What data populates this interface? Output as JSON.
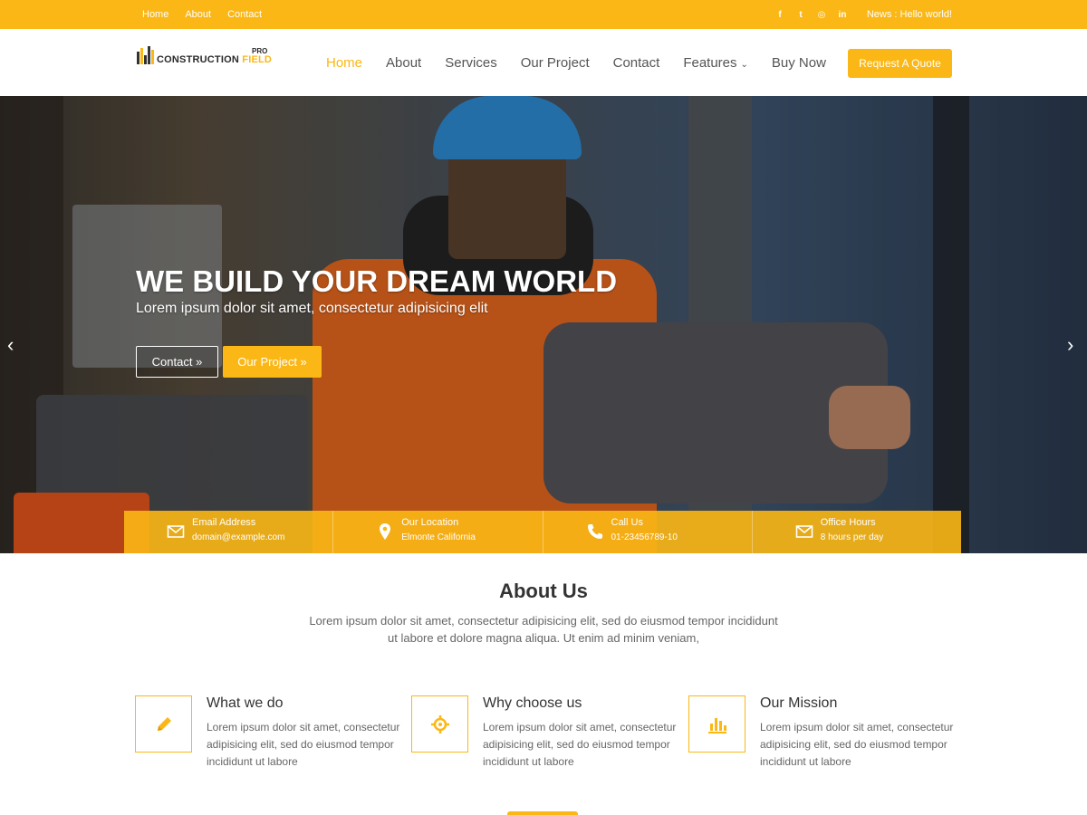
{
  "colors": {
    "accent": "#fbb715",
    "text": "#333333",
    "muted": "#666666"
  },
  "topbar": {
    "links": [
      "Home",
      "About",
      "Contact"
    ],
    "social_icons": [
      "facebook-icon",
      "twitter-icon",
      "instagram-icon",
      "linkedin-icon"
    ],
    "social_glyphs": [
      "f",
      "t",
      "◎",
      "in"
    ],
    "news": "News : Hello world!"
  },
  "logo": {
    "brand_dark": "CONSTRUCTION",
    "brand_accent": "FIELD",
    "badge": "PRO"
  },
  "nav": {
    "items": [
      "Home",
      "About",
      "Services",
      "Our Project",
      "Contact",
      "Features",
      "Buy Now"
    ],
    "active": "Home",
    "cta": "Request A Quote"
  },
  "hero": {
    "headline": "WE BUILD YOUR DREAM WORLD",
    "subheading": "Lorem ipsum dolor sit amet, consectetur adipisicing elit",
    "btn_contact": "Contact »",
    "btn_project": "Our Project »",
    "prev_arrow": "‹",
    "next_arrow": "›"
  },
  "info": [
    {
      "icon": "envelope-icon",
      "title": "Email Address",
      "value": "domain@example.com"
    },
    {
      "icon": "map-marker-icon",
      "title": "Our Location",
      "value": "Elmonte California"
    },
    {
      "icon": "phone-icon",
      "title": "Call Us",
      "value": "01-23456789-10"
    },
    {
      "icon": "envelope-icon",
      "title": "Office Hours",
      "value": "8 hours per day"
    }
  ],
  "about": {
    "title": "About Us",
    "text": "Lorem ipsum dolor sit amet, consectetur adipisicing elit, sed do eiusmod tempor incididunt ut labore et dolore magna aliqua. Ut enim ad minim veniam,"
  },
  "features": [
    {
      "icon": "pencil-icon",
      "title": "What we do",
      "text": "Lorem ipsum dolor sit amet, consectetur adipisicing elit, sed do eiusmod tempor incididunt ut labore"
    },
    {
      "icon": "crosshair-icon",
      "title": "Why choose us",
      "text": "Lorem ipsum dolor sit amet, consectetur adipisicing elit, sed do eiusmod tempor incididunt ut labore"
    },
    {
      "icon": "bar-chart-icon",
      "title": "Our Mission",
      "text": "Lorem ipsum dolor sit amet, consectetur adipisicing elit, sed do eiusmod tempor incididunt ut labore"
    }
  ]
}
